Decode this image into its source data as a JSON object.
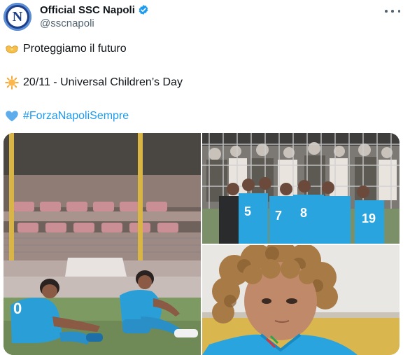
{
  "tweet": {
    "display_name": "Official SSC Napoli",
    "handle": "@sscnapoli",
    "avatar_letter": "N",
    "lines": [
      "Proteggiamo il futuro",
      "20/11 - Universal Children’s Day",
      "#ForzaNapoliSempre"
    ]
  },
  "media": {
    "photo1": {
      "jersey_number": "0"
    },
    "photo2": {
      "jersey_numbers": [
        "5",
        "7",
        "8",
        "19"
      ]
    }
  },
  "colors": {
    "text": "#0f1419",
    "secondary": "#536471",
    "link": "#1d9bf0",
    "verified": "#1d9bf0",
    "napoli_blue": "#2aa4df"
  },
  "icons": [
    "more-icon",
    "verified-badge-icon",
    "handshake-heart-icon",
    "sun-icon",
    "blue-heart-icon"
  ]
}
